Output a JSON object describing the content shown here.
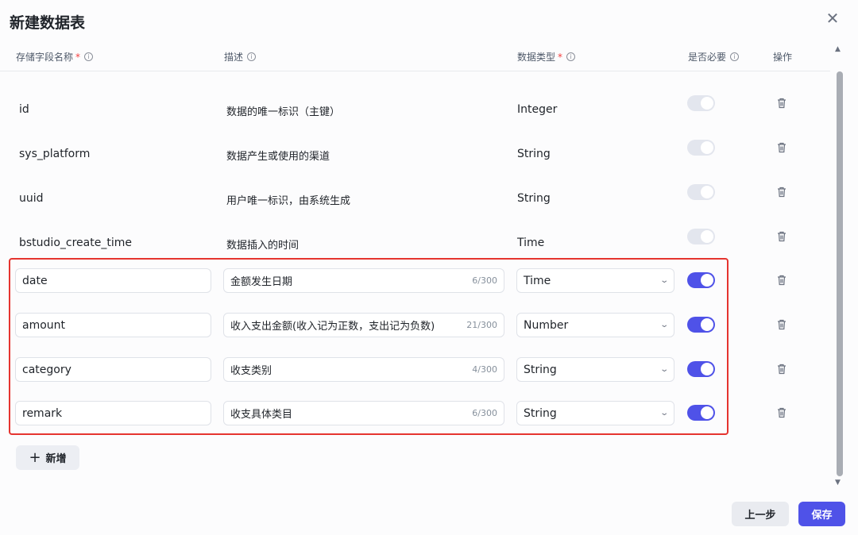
{
  "dialog": {
    "title": "新建数据表",
    "close_icon": "close-icon"
  },
  "columns": {
    "name": "存储字段名称",
    "desc": "描述",
    "type": "数据类型",
    "required": "是否必要",
    "actions": "操作",
    "required_marker": "*"
  },
  "static_rows": [
    {
      "name": "id",
      "desc": "数据的唯一标识（主键）",
      "type": "Integer",
      "required": false
    },
    {
      "name": "sys_platform",
      "desc": "数据产生或使用的渠道",
      "type": "String",
      "required": false
    },
    {
      "name": "uuid",
      "desc": "用户唯一标识，由系统生成",
      "type": "String",
      "required": false
    },
    {
      "name": "bstudio_create_time",
      "desc": "数据插入的时间",
      "type": "Time",
      "required": false
    }
  ],
  "edit_rows": [
    {
      "name": "date",
      "desc": "金额发生日期",
      "count": "6/300",
      "type": "Time",
      "required": true
    },
    {
      "name": "amount",
      "desc": "收入支出金额(收入记为正数，支出记为负数)",
      "count": "21/300",
      "type": "Number",
      "required": true
    },
    {
      "name": "category",
      "desc": "收支类别",
      "count": "4/300",
      "type": "String",
      "required": true
    },
    {
      "name": "remark",
      "desc": "收支具体类目",
      "count": "6/300",
      "type": "String",
      "required": true
    }
  ],
  "add_button": {
    "label": "新增",
    "icon": "plus-icon"
  },
  "footer": {
    "prev_label": "上一步",
    "save_label": "保存"
  },
  "colors": {
    "accent": "#4f52e8",
    "highlight": "#e5342f"
  }
}
